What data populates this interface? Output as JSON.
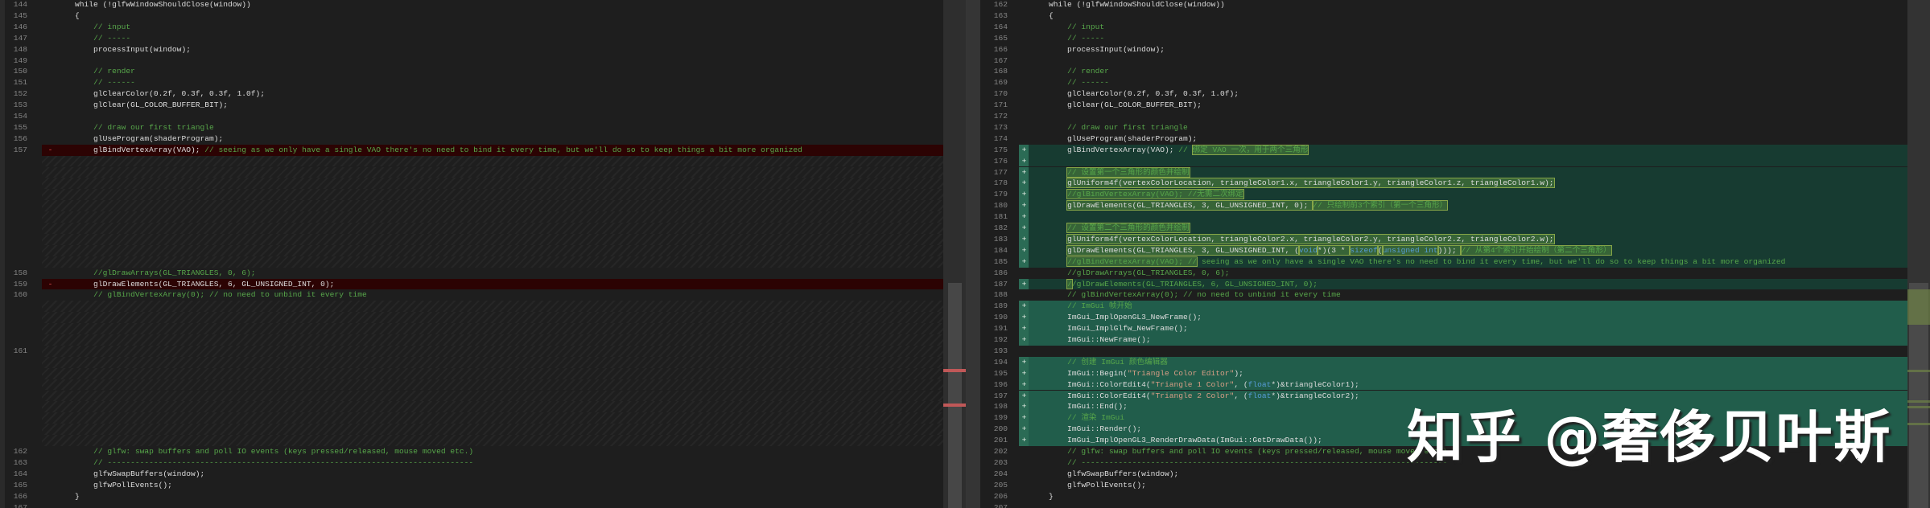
{
  "colors": {
    "removed": "#2c0303",
    "added": "#173b31",
    "added_bright": "#215d4b",
    "comment": "#57a64a",
    "keyword": "#569cd6",
    "string": "#d69d85"
  },
  "left": {
    "rows": [
      {
        "n": "144",
        "s": [
          [
            "code",
            "    while (!glfwWindowShouldClose(window))"
          ]
        ]
      },
      {
        "n": "145",
        "s": [
          [
            "code",
            "    {"
          ]
        ]
      },
      {
        "n": "146",
        "s": [
          [
            "code",
            "        "
          ],
          [
            "cmt",
            "// input"
          ]
        ]
      },
      {
        "n": "147",
        "s": [
          [
            "code",
            "        "
          ],
          [
            "cmt",
            "// -----"
          ]
        ]
      },
      {
        "n": "148",
        "s": [
          [
            "code",
            "        processInput(window);"
          ]
        ]
      },
      {
        "n": "149",
        "s": []
      },
      {
        "n": "150",
        "s": [
          [
            "code",
            "        "
          ],
          [
            "cmt",
            "// render"
          ]
        ]
      },
      {
        "n": "151",
        "s": [
          [
            "code",
            "        "
          ],
          [
            "cmt",
            "// ------"
          ]
        ]
      },
      {
        "n": "152",
        "s": [
          [
            "code",
            "        glClearColor(0.2f, 0.3f, 0.3f, 1.0f);"
          ]
        ]
      },
      {
        "n": "153",
        "s": [
          [
            "code",
            "        glClear(GL_COLOR_BUFFER_BIT);"
          ]
        ]
      },
      {
        "n": "154",
        "s": []
      },
      {
        "n": "155",
        "s": [
          [
            "code",
            "        "
          ],
          [
            "cmt",
            "// draw our first triangle"
          ]
        ]
      },
      {
        "n": "156",
        "s": [
          [
            "code",
            "        glUseProgram(shaderProgram);"
          ]
        ]
      },
      {
        "n": "157",
        "k": "removed",
        "m": "-",
        "s": [
          [
            "code",
            "        glBindVertexArray(VAO); "
          ],
          [
            "cmt",
            "// seeing as we only have a single VAO there's no need to bind it every time, but we'll do so to keep things a bit more organized"
          ]
        ]
      },
      {
        "k": "pad"
      },
      {
        "k": "pad"
      },
      {
        "k": "pad"
      },
      {
        "k": "pad"
      },
      {
        "k": "pad"
      },
      {
        "k": "pad"
      },
      {
        "k": "pad"
      },
      {
        "k": "pad"
      },
      {
        "k": "pad"
      },
      {
        "k": "pad"
      },
      {
        "n": "158",
        "s": [
          [
            "code",
            "        "
          ],
          [
            "cmt",
            "//glDrawArrays(GL_TRIANGLES, 0, 6);"
          ]
        ]
      },
      {
        "n": "159",
        "k": "removed",
        "m": "-",
        "s": [
          [
            "code",
            "        glDrawElements(GL_TRIANGLES, 6, GL_UNSIGNED_INT, 0);"
          ]
        ]
      },
      {
        "n": "160",
        "s": [
          [
            "code",
            "        "
          ],
          [
            "cmt",
            "// glBindVertexArray(0); // no need to unbind it every time"
          ]
        ]
      },
      {
        "k": "pad"
      },
      {
        "k": "pad"
      },
      {
        "k": "pad"
      },
      {
        "k": "pad"
      },
      {
        "n": "161",
        "k": "pad",
        "s": []
      },
      {
        "k": "pad"
      },
      {
        "k": "pad"
      },
      {
        "k": "pad"
      },
      {
        "k": "pad"
      },
      {
        "k": "pad"
      },
      {
        "k": "pad"
      },
      {
        "k": "pad"
      },
      {
        "k": "pad"
      },
      {
        "n": "162",
        "s": [
          [
            "code",
            "        "
          ],
          [
            "cmt",
            "// glfw: swap buffers and poll IO events (keys pressed/released, mouse moved etc.)"
          ]
        ]
      },
      {
        "n": "163",
        "s": [
          [
            "code",
            "        "
          ],
          [
            "cmt",
            "// -------------------------------------------------------------------------------"
          ]
        ]
      },
      {
        "n": "164",
        "s": [
          [
            "code",
            "        glfwSwapBuffers(window);"
          ]
        ]
      },
      {
        "n": "165",
        "s": [
          [
            "code",
            "        glfwPollEvents();"
          ]
        ]
      },
      {
        "n": "166",
        "s": [
          [
            "code",
            "    }"
          ]
        ]
      },
      {
        "n": "167",
        "s": []
      }
    ]
  },
  "right": {
    "rows": [
      {
        "n": "162",
        "s": [
          [
            "code",
            "    while (!glfwWindowShouldClose(window))"
          ]
        ]
      },
      {
        "n": "163",
        "s": [
          [
            "code",
            "    {"
          ]
        ]
      },
      {
        "n": "164",
        "s": [
          [
            "code",
            "        "
          ],
          [
            "cmt",
            "// input"
          ]
        ]
      },
      {
        "n": "165",
        "s": [
          [
            "code",
            "        "
          ],
          [
            "cmt",
            "// -----"
          ]
        ]
      },
      {
        "n": "166",
        "s": [
          [
            "code",
            "        processInput(window);"
          ]
        ]
      },
      {
        "n": "167",
        "s": []
      },
      {
        "n": "168",
        "s": [
          [
            "code",
            "        "
          ],
          [
            "cmt",
            "// render"
          ]
        ]
      },
      {
        "n": "169",
        "s": [
          [
            "code",
            "        "
          ],
          [
            "cmt",
            "// ------"
          ]
        ]
      },
      {
        "n": "170",
        "s": [
          [
            "code",
            "        glClearColor(0.2f, 0.3f, 0.3f, 1.0f);"
          ]
        ]
      },
      {
        "n": "171",
        "s": [
          [
            "code",
            "        glClear(GL_COLOR_BUFFER_BIT);"
          ]
        ]
      },
      {
        "n": "172",
        "s": []
      },
      {
        "n": "173",
        "s": [
          [
            "code",
            "        "
          ],
          [
            "cmt",
            "// draw our first triangle"
          ]
        ]
      },
      {
        "n": "174",
        "s": [
          [
            "code",
            "        glUseProgram(shaderProgram);"
          ]
        ]
      },
      {
        "n": "175",
        "k": "added1",
        "m": "+",
        "s": [
          [
            "code",
            "        glBindVertexArray(VAO); "
          ],
          [
            "cmt",
            "// "
          ],
          [
            "cmt",
            "绑定 VAO 一次，用于两个三角形",
            1
          ]
        ]
      },
      {
        "n": "176",
        "k": "added1",
        "m": "+",
        "s": []
      },
      {
        "n": "177",
        "k": "added1",
        "m": "+",
        "s": [
          [
            "code",
            "        "
          ],
          [
            "cmt",
            "// 设置第一个三角形的颜色并绘制",
            1
          ]
        ]
      },
      {
        "n": "178",
        "k": "added1",
        "m": "+",
        "s": [
          [
            "code",
            "        "
          ],
          [
            "code",
            "glUniform4f(vertexColorLocation, triangleColor1.x, triangleColor1.y, triangleColor1.z, triangleColor1.w);",
            1
          ]
        ]
      },
      {
        "n": "179",
        "k": "added1",
        "m": "+",
        "s": [
          [
            "code",
            "        "
          ],
          [
            "cmt",
            "//glBindVertexArray(VAO); //无需二次绑定",
            1
          ]
        ]
      },
      {
        "n": "180",
        "k": "added1",
        "m": "+",
        "s": [
          [
            "code",
            "        "
          ],
          [
            "code",
            "glDrawElements(GL_TRIANGLES, 3, GL_UNSIGNED_INT, 0); ",
            1
          ],
          [
            "cmt",
            "// 只绘制前3个索引（第一个三角形）",
            1
          ]
        ]
      },
      {
        "n": "181",
        "k": "added1",
        "m": "+",
        "s": []
      },
      {
        "n": "182",
        "k": "added1",
        "m": "+",
        "s": [
          [
            "code",
            "        "
          ],
          [
            "cmt",
            "// 设置第二个三角形的颜色并绘制",
            1
          ]
        ]
      },
      {
        "n": "183",
        "k": "added1",
        "m": "+",
        "s": [
          [
            "code",
            "        "
          ],
          [
            "code",
            "glUniform4f(vertexColorLocation, triangleColor2.x, triangleColor2.y, triangleColor2.z, triangleColor2.w);",
            1
          ]
        ]
      },
      {
        "n": "184",
        "k": "added1",
        "m": "+",
        "s": [
          [
            "code",
            "        "
          ],
          [
            "code",
            "glDrawElements(GL_TRIANGLES, 3, GL_UNSIGNED_INT, (",
            1
          ],
          [
            "kw",
            "void",
            1
          ],
          [
            "code",
            "*)(3 * ",
            1
          ],
          [
            "kw",
            "sizeof",
            1
          ],
          [
            "code",
            "(",
            1
          ],
          [
            "kw",
            "unsigned int",
            1
          ],
          [
            "code",
            "))); ",
            1
          ],
          [
            "cmt",
            "// 从第4个索引开始绘制（第二个三角形）",
            1
          ]
        ]
      },
      {
        "n": "185",
        "k": "added1",
        "m": "+",
        "s": [
          [
            "code",
            "        "
          ],
          [
            "cmt",
            "//glBindVertexArray(VAO); //",
            1
          ],
          [
            "cmt",
            " seeing as we only have a single VAO there's no need to bind it every time, but we'll do so to keep things a bit more organized"
          ]
        ]
      },
      {
        "n": "186",
        "s": [
          [
            "code",
            "        "
          ],
          [
            "cmt",
            "//glDrawArrays(GL_TRIANGLES, 0, 6);"
          ]
        ]
      },
      {
        "n": "187",
        "k": "added1",
        "m": "+",
        "s": [
          [
            "code",
            "        "
          ],
          [
            "cmt",
            "/",
            1
          ],
          [
            "cmt",
            "/glDrawElements(GL_TRIANGLES, 6, GL_UNSIGNED_INT, 0);"
          ]
        ]
      },
      {
        "n": "188",
        "s": [
          [
            "code",
            "        "
          ],
          [
            "cmt",
            "// glBindVertexArray(0); // no need to unbind it every time"
          ]
        ]
      },
      {
        "n": "189",
        "k": "added2",
        "m": "+",
        "s": [
          [
            "code",
            "        "
          ],
          [
            "cmt",
            "// ImGui 帧开始"
          ]
        ]
      },
      {
        "n": "190",
        "k": "added2",
        "m": "+",
        "s": [
          [
            "code",
            "        ImGui_ImplOpenGL3_NewFrame();"
          ]
        ]
      },
      {
        "n": "191",
        "k": "added2",
        "m": "+",
        "s": [
          [
            "code",
            "        ImGui_ImplGlfw_NewFrame();"
          ]
        ]
      },
      {
        "n": "192",
        "k": "added2",
        "m": "+",
        "s": [
          [
            "code",
            "        ImGui::NewFrame();"
          ]
        ]
      },
      {
        "n": "193",
        "s": []
      },
      {
        "n": "194",
        "k": "added2",
        "m": "+",
        "s": [
          [
            "code",
            "        "
          ],
          [
            "cmt",
            "// 创建 ImGui 颜色编辑器"
          ]
        ]
      },
      {
        "n": "195",
        "k": "added2",
        "m": "+",
        "s": [
          [
            "code",
            "        ImGui::Begin("
          ],
          [
            "str",
            "\"Triangle Color Editor\""
          ],
          [
            "code",
            ");"
          ]
        ]
      },
      {
        "n": "196",
        "k": "added2",
        "m": "+",
        "s": [
          [
            "code",
            "        ImGui::ColorEdit4("
          ],
          [
            "str",
            "\"Triangle 1 Color\""
          ],
          [
            "code",
            ", ("
          ],
          [
            "kw",
            "float"
          ],
          [
            "code",
            "*)&triangleColor1);"
          ]
        ]
      },
      {
        "n": "197",
        "k": "added2",
        "m": "+",
        "s": [
          [
            "code",
            "        ImGui::ColorEdit4("
          ],
          [
            "str",
            "\"Triangle 2 Color\""
          ],
          [
            "code",
            ", ("
          ],
          [
            "kw",
            "float"
          ],
          [
            "code",
            "*)&triangleColor2);"
          ]
        ]
      },
      {
        "n": "198",
        "k": "added2",
        "m": "+",
        "s": [
          [
            "code",
            "        ImGui::End();"
          ]
        ]
      },
      {
        "n": "199",
        "k": "added2",
        "m": "+",
        "s": [
          [
            "code",
            "        "
          ],
          [
            "cmt",
            "// 渲染 ImGui"
          ]
        ]
      },
      {
        "n": "200",
        "k": "added2",
        "m": "+",
        "s": [
          [
            "code",
            "        ImGui::Render();"
          ]
        ]
      },
      {
        "n": "201",
        "k": "added2",
        "m": "+",
        "s": [
          [
            "code",
            "        ImGui_ImplOpenGL3_RenderDrawData(ImGui::GetDrawData());"
          ]
        ]
      },
      {
        "n": "202",
        "s": [
          [
            "code",
            "        "
          ],
          [
            "cmt",
            "// glfw: swap buffers and poll IO events (keys pressed/released, mouse moved etc.)"
          ]
        ]
      },
      {
        "n": "203",
        "s": [
          [
            "code",
            "        "
          ],
          [
            "cmt",
            "// -------------------------------------------------------------------------------"
          ]
        ]
      },
      {
        "n": "204",
        "s": [
          [
            "code",
            "        glfwSwapBuffers(window);"
          ]
        ]
      },
      {
        "n": "205",
        "s": [
          [
            "code",
            "        glfwPollEvents();"
          ]
        ]
      },
      {
        "n": "206",
        "s": [
          [
            "code",
            "    }"
          ]
        ]
      },
      {
        "n": "207",
        "s": []
      }
    ]
  },
  "watermark": "知乎 @奢侈贝叶斯"
}
